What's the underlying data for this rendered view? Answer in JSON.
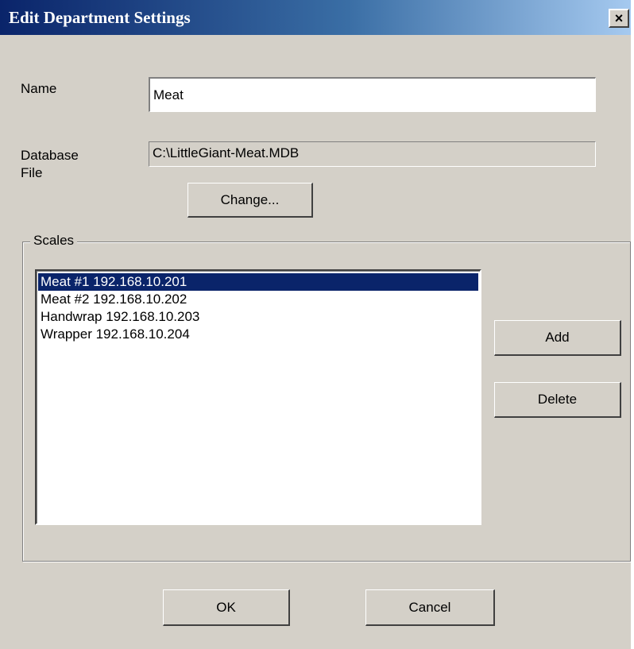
{
  "window": {
    "title": "Edit Department Settings",
    "close_glyph": "×"
  },
  "form": {
    "name_label": "Name",
    "name_value": "Meat",
    "database_label_line1": "Database",
    "database_label_line2": "File",
    "database_value": "C:\\LittleGiant-Meat.MDB",
    "change_button": "Change..."
  },
  "scales": {
    "group_label": "Scales",
    "items": [
      {
        "label": "Meat #1 192.168.10.201",
        "selected": true
      },
      {
        "label": "Meat #2 192.168.10.202",
        "selected": false
      },
      {
        "label": "Handwrap 192.168.10.203",
        "selected": false
      },
      {
        "label": "Wrapper 192.168.10.204",
        "selected": false
      }
    ],
    "add_button": "Add",
    "delete_button": "Delete"
  },
  "footer": {
    "ok_button": "OK",
    "cancel_button": "Cancel"
  },
  "colors": {
    "title_gradient_start": "#0a246a",
    "title_gradient_end": "#a6caf0",
    "face": "#d4d0c8",
    "selection": "#0a246a"
  },
  "icons": {
    "close": "close-icon"
  }
}
